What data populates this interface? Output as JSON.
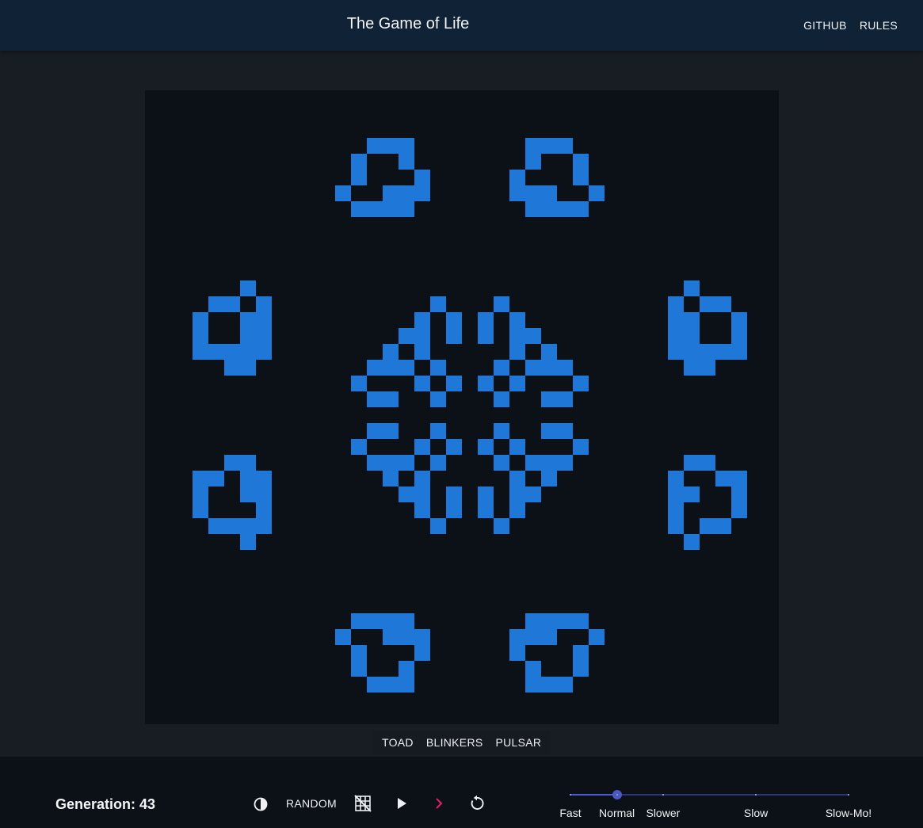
{
  "header": {
    "title": "The Game of Life",
    "nav": [
      "GITHUB",
      "RULES"
    ]
  },
  "board": {
    "cell_color": "#1f78d8",
    "background_color": "#0c1117",
    "live_cells": [
      [
        3,
        14
      ],
      [
        3,
        15
      ],
      [
        3,
        16
      ],
      [
        3,
        24
      ],
      [
        3,
        25
      ],
      [
        3,
        26
      ],
      [
        4,
        13
      ],
      [
        4,
        16
      ],
      [
        4,
        24
      ],
      [
        4,
        27
      ],
      [
        5,
        13
      ],
      [
        5,
        17
      ],
      [
        5,
        23
      ],
      [
        5,
        27
      ],
      [
        6,
        12
      ],
      [
        6,
        15
      ],
      [
        6,
        16
      ],
      [
        6,
        17
      ],
      [
        6,
        23
      ],
      [
        6,
        24
      ],
      [
        6,
        25
      ],
      [
        6,
        28
      ],
      [
        7,
        13
      ],
      [
        7,
        14
      ],
      [
        7,
        15
      ],
      [
        7,
        16
      ],
      [
        7,
        24
      ],
      [
        7,
        25
      ],
      [
        7,
        26
      ],
      [
        7,
        27
      ],
      [
        12,
        6
      ],
      [
        12,
        34
      ],
      [
        13,
        4
      ],
      [
        13,
        5
      ],
      [
        13,
        7
      ],
      [
        13,
        18
      ],
      [
        13,
        22
      ],
      [
        13,
        35
      ],
      [
        13,
        36
      ],
      [
        13,
        33
      ],
      [
        14,
        3
      ],
      [
        14,
        6
      ],
      [
        14,
        7
      ],
      [
        14,
        17
      ],
      [
        14,
        19
      ],
      [
        14,
        21
      ],
      [
        14,
        23
      ],
      [
        14,
        33
      ],
      [
        14,
        34
      ],
      [
        14,
        37
      ],
      [
        15,
        3
      ],
      [
        15,
        6
      ],
      [
        15,
        7
      ],
      [
        15,
        16
      ],
      [
        15,
        17
      ],
      [
        15,
        19
      ],
      [
        15,
        21
      ],
      [
        15,
        23
      ],
      [
        15,
        24
      ],
      [
        15,
        33
      ],
      [
        15,
        34
      ],
      [
        15,
        37
      ],
      [
        16,
        3
      ],
      [
        16,
        4
      ],
      [
        16,
        5
      ],
      [
        16,
        6
      ],
      [
        16,
        7
      ],
      [
        16,
        15
      ],
      [
        16,
        17
      ],
      [
        16,
        23
      ],
      [
        16,
        25
      ],
      [
        16,
        33
      ],
      [
        16,
        34
      ],
      [
        16,
        35
      ],
      [
        16,
        36
      ],
      [
        16,
        37
      ],
      [
        17,
        5
      ],
      [
        17,
        6
      ],
      [
        17,
        14
      ],
      [
        17,
        15
      ],
      [
        17,
        16
      ],
      [
        17,
        18
      ],
      [
        17,
        22
      ],
      [
        17,
        24
      ],
      [
        17,
        25
      ],
      [
        17,
        26
      ],
      [
        17,
        34
      ],
      [
        17,
        35
      ],
      [
        18,
        13
      ],
      [
        18,
        17
      ],
      [
        18,
        19
      ],
      [
        18,
        21
      ],
      [
        18,
        23
      ],
      [
        18,
        27
      ],
      [
        19,
        14
      ],
      [
        19,
        15
      ],
      [
        19,
        18
      ],
      [
        19,
        22
      ],
      [
        19,
        25
      ],
      [
        19,
        26
      ],
      [
        21,
        14
      ],
      [
        21,
        15
      ],
      [
        21,
        18
      ],
      [
        21,
        22
      ],
      [
        21,
        25
      ],
      [
        21,
        26
      ],
      [
        22,
        13
      ],
      [
        22,
        17
      ],
      [
        22,
        19
      ],
      [
        22,
        21
      ],
      [
        22,
        23
      ],
      [
        22,
        27
      ],
      [
        23,
        5
      ],
      [
        23,
        6
      ],
      [
        23,
        14
      ],
      [
        23,
        15
      ],
      [
        23,
        16
      ],
      [
        23,
        18
      ],
      [
        23,
        22
      ],
      [
        23,
        24
      ],
      [
        23,
        25
      ],
      [
        23,
        26
      ],
      [
        23,
        34
      ],
      [
        23,
        35
      ],
      [
        24,
        3
      ],
      [
        24,
        4
      ],
      [
        24,
        6
      ],
      [
        24,
        7
      ],
      [
        24,
        15
      ],
      [
        24,
        17
      ],
      [
        24,
        23
      ],
      [
        24,
        25
      ],
      [
        24,
        33
      ],
      [
        24,
        36
      ],
      [
        24,
        37
      ],
      [
        25,
        3
      ],
      [
        25,
        6
      ],
      [
        25,
        7
      ],
      [
        25,
        16
      ],
      [
        25,
        17
      ],
      [
        25,
        19
      ],
      [
        25,
        21
      ],
      [
        25,
        23
      ],
      [
        25,
        24
      ],
      [
        25,
        33
      ],
      [
        25,
        34
      ],
      [
        25,
        37
      ],
      [
        26,
        3
      ],
      [
        26,
        7
      ],
      [
        26,
        17
      ],
      [
        26,
        19
      ],
      [
        26,
        21
      ],
      [
        26,
        23
      ],
      [
        26,
        33
      ],
      [
        26,
        37
      ],
      [
        27,
        4
      ],
      [
        27,
        5
      ],
      [
        27,
        6
      ],
      [
        27,
        7
      ],
      [
        27,
        18
      ],
      [
        27,
        22
      ],
      [
        27,
        33
      ],
      [
        27,
        35
      ],
      [
        27,
        36
      ],
      [
        28,
        6
      ],
      [
        28,
        34
      ],
      [
        33,
        13
      ],
      [
        33,
        14
      ],
      [
        33,
        15
      ],
      [
        33,
        16
      ],
      [
        33,
        24
      ],
      [
        33,
        25
      ],
      [
        33,
        26
      ],
      [
        33,
        27
      ],
      [
        34,
        12
      ],
      [
        34,
        15
      ],
      [
        34,
        16
      ],
      [
        34,
        17
      ],
      [
        34,
        23
      ],
      [
        34,
        24
      ],
      [
        34,
        25
      ],
      [
        34,
        28
      ],
      [
        35,
        13
      ],
      [
        35,
        17
      ],
      [
        35,
        23
      ],
      [
        35,
        27
      ],
      [
        36,
        13
      ],
      [
        36,
        16
      ],
      [
        36,
        24
      ],
      [
        36,
        27
      ],
      [
        37,
        14
      ],
      [
        37,
        15
      ],
      [
        37,
        16
      ],
      [
        37,
        24
      ],
      [
        37,
        25
      ],
      [
        37,
        26
      ]
    ]
  },
  "patterns": [
    "TOAD",
    "BLINKERS",
    "PULSAR"
  ],
  "controls": {
    "generation_label": "Generation: 43",
    "random_label": "RANDOM",
    "next_arrow_color": "#e91e63",
    "icons": [
      "contrast-icon",
      "grid-off-icon",
      "play-icon",
      "chevron-right-icon",
      "restart-icon"
    ]
  },
  "speed": {
    "selected": "Normal",
    "selected_fraction": 0.167,
    "marks": [
      {
        "label": "Fast",
        "fraction": 0.0
      },
      {
        "label": "Normal",
        "fraction": 0.167
      },
      {
        "label": "Slower",
        "fraction": 0.333
      },
      {
        "label": "Slow",
        "fraction": 0.667
      },
      {
        "label": "Slow-Mo!",
        "fraction": 1.0
      }
    ]
  }
}
